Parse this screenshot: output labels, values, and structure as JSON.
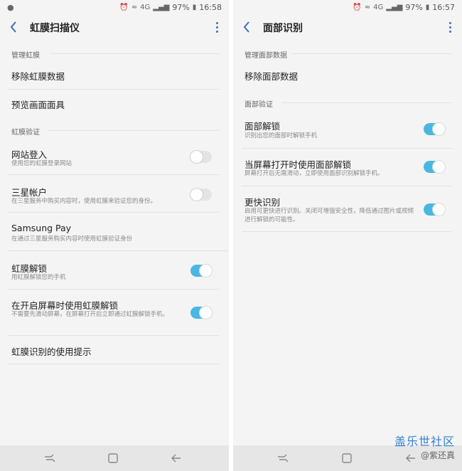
{
  "left": {
    "status": {
      "battery": "97%",
      "time": "16:58",
      "network": "4G"
    },
    "title": "虹膜扫描仪",
    "section1": "管理虹膜",
    "remove_label": "移除虹膜数据",
    "preview_label": "预览画面面具",
    "section2": "虹膜验证",
    "website_title": "网站登入",
    "website_sub": "使用您的虹膜登录网站",
    "samsung_account_title": "三星帐户",
    "samsung_account_sub": "在三星服务中购买内容时，使用虹膜来验证您的身份。",
    "samsung_pay_title": "Samsung Pay",
    "samsung_pay_sub": "在通过三星服务购买内容时使用虹膜验证身份",
    "unlock_title": "虹膜解锁",
    "unlock_sub": "用虹膜解锁您的手机",
    "screenon_title": "在开启屏幕时使用虹膜解锁",
    "screenon_sub": "不需要先滑动屏幕，在屏幕打开后立即通过虹膜解锁手机。",
    "tips_label": "虹膜识别的使用提示"
  },
  "right": {
    "status": {
      "battery": "97%",
      "time": "16:57",
      "network": "4G"
    },
    "title": "面部识别",
    "section1": "管理面部数据",
    "remove_label": "移除面部数据",
    "section2": "面部验证",
    "unlock_title": "面部解锁",
    "unlock_sub": "识别出您的面部时解锁手机",
    "screenon_title": "当屏幕打开时使用面部解锁",
    "screenon_sub": "屏幕打开后无需滑动，立即使用面部识别解锁手机。",
    "faster_title": "更快识别",
    "faster_sub": "启用可更快进行识别。关闭可增强安全性，降低通过图片或视频进行解锁的可能性。"
  },
  "toggles": {
    "left_website": false,
    "left_samsung_account": false,
    "left_unlock": true,
    "left_screenon": true,
    "right_unlock": true,
    "right_screenon": true,
    "right_faster": true
  },
  "watermark": {
    "title": "盖乐世社区",
    "sub": "@紫还真"
  },
  "colors": {
    "accent": "#49b7e2",
    "back_arrow": "#3c6fbe",
    "background": "#f4f4f4",
    "watermark": "#2f7fd0"
  }
}
